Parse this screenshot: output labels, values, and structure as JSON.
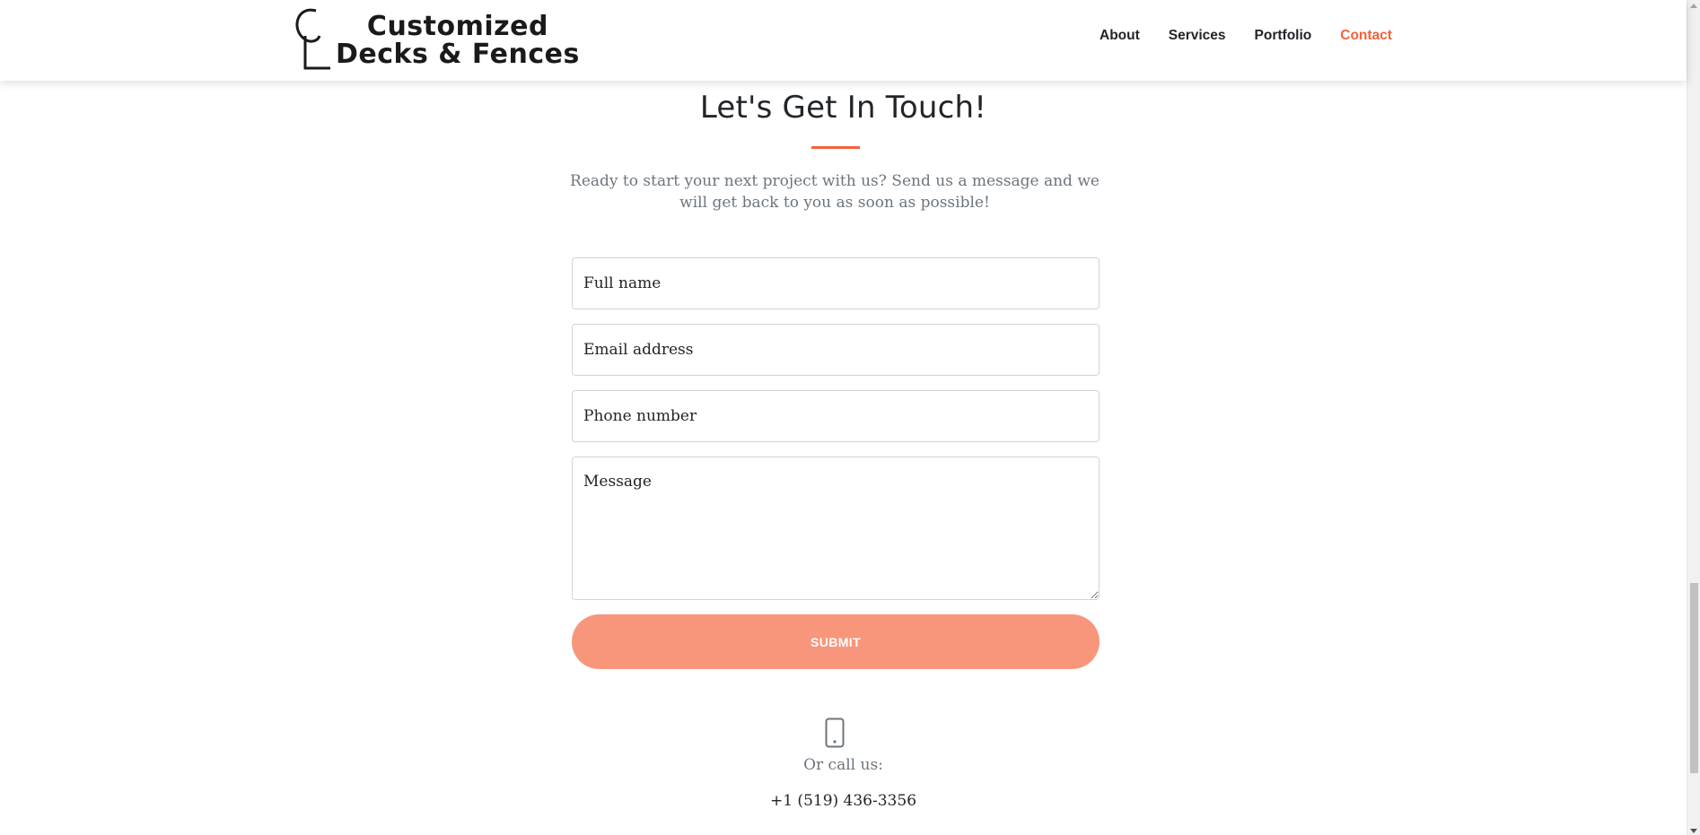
{
  "brand": {
    "line1": "Customized",
    "line2": "Decks & Fences",
    "monogram": "CL"
  },
  "nav": {
    "items": [
      {
        "label": "About",
        "active": false
      },
      {
        "label": "Services",
        "active": false
      },
      {
        "label": "Portfolio",
        "active": false
      },
      {
        "label": "Contact",
        "active": true
      }
    ]
  },
  "contact": {
    "title": "Let's Get In Touch!",
    "lead": "Ready to start your next project with us? Send us a message and we will get back to you as soon as possible!",
    "form": {
      "name_placeholder": "Full name",
      "email_placeholder": "Email address",
      "phone_placeholder": "Phone number",
      "message_placeholder": "Message",
      "submit_label": "Submit"
    },
    "call_label": "Or call us:",
    "phone_number": "+1 (519) 436-3356",
    "phone_icon": "phone-icon"
  },
  "colors": {
    "accent": "#f4623a",
    "submit_bg": "#f8967c",
    "muted_text": "#6c757d"
  }
}
